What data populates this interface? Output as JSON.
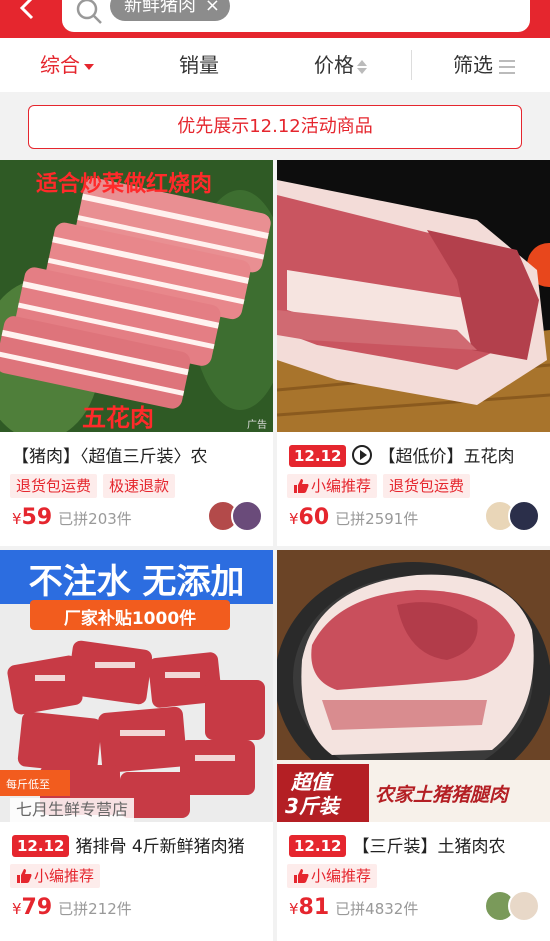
{
  "header": {
    "search_keyword": "新鲜猪肉",
    "chip_close": "×"
  },
  "sort": {
    "items": [
      "综合",
      "销量",
      "价格",
      "筛选"
    ]
  },
  "banner": {
    "text": "优先展示12.12活动商品"
  },
  "colors": {
    "brand": "#e5262e",
    "tag_bg": "#fdeceb"
  },
  "products": [
    {
      "image_overlay_top": "适合炒菜做红烧肉",
      "image_overlay_bottom": "五花肉",
      "image_ad_label": "广告",
      "title": "【猪肉】〈超值三斤装〉农",
      "tags": [
        "退货包运费",
        "极速退款"
      ],
      "currency": "¥",
      "price": "59",
      "sold": "已拼203件"
    },
    {
      "badge": "12.12",
      "title": "【超低价】五花肉",
      "tags": [
        "小编推荐",
        "退货包运费"
      ],
      "currency": "¥",
      "price": "60",
      "sold": "已拼2591件"
    },
    {
      "image_headline": "不注水 无添加",
      "image_ribbon": "厂家补贴1000件",
      "image_corner": "每斤低至",
      "store_name": "七月生鲜专营店",
      "badge": "12.12",
      "title": "猪排骨 4斤新鲜猪肉猪",
      "tags": [
        "小编推荐"
      ],
      "currency": "¥",
      "price": "79",
      "sold": "已拼212件"
    },
    {
      "image_caption_left_1": "超值",
      "image_caption_left_2": "3斤装",
      "image_caption_right": "农家土猪猪腿肉",
      "badge": "12.12",
      "title": "【三斤装】土猪肉农",
      "tags": [
        "小编推荐"
      ],
      "currency": "¥",
      "price": "81",
      "sold": "已拼4832件"
    }
  ]
}
